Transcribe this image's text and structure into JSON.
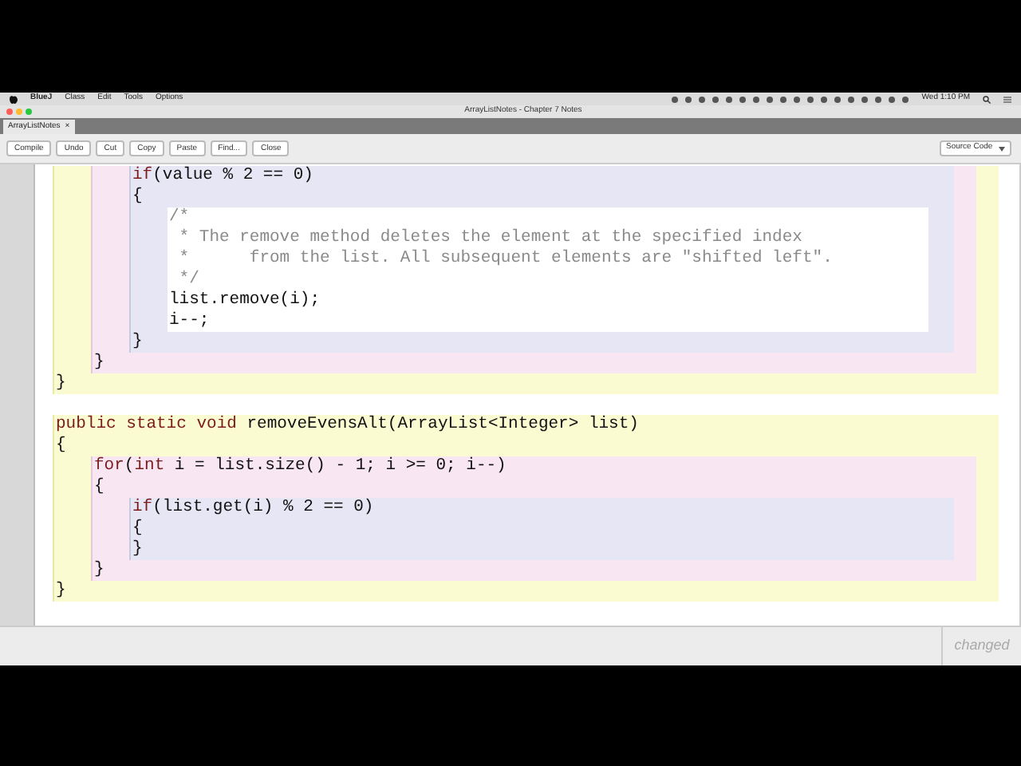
{
  "menu_bar": {
    "items": [
      "BlueJ",
      "Class",
      "Edit",
      "Tools",
      "Options"
    ],
    "clock": "Wed 1:10 PM"
  },
  "window": {
    "title": "ArrayListNotes - Chapter 7 Notes"
  },
  "tabs": [
    {
      "label": "ArrayListNotes",
      "close": "×",
      "selected": true
    }
  ],
  "toolbar": {
    "buttons": [
      "Compile",
      "Undo",
      "Cut",
      "Copy",
      "Paste",
      "Find...",
      "Close"
    ],
    "view_select": "Source Code"
  },
  "editor": {
    "items": [
      {
        "kind": "method",
        "items": [
          {
            "kind": "loop",
            "items": [
              {
                "kind": "if",
                "items": [
                  {
                    "kind": "line",
                    "tokens": [
                      {
                        "kind": "keyword",
                        "text": "if"
                      },
                      {
                        "kind": "plain",
                        "text": "(value % 2 == 0)"
                      }
                    ]
                  },
                  {
                    "kind": "line",
                    "tokens": [
                      {
                        "kind": "plain",
                        "text": "{"
                      }
                    ]
                  },
                  {
                    "kind": "comment",
                    "items": [
                      {
                        "kind": "line",
                        "tokens": [
                          {
                            "kind": "comment",
                            "text": "/*"
                          }
                        ]
                      },
                      {
                        "kind": "line",
                        "tokens": [
                          {
                            "kind": "comment",
                            "text": " * The remove method deletes the element at the specified index"
                          }
                        ]
                      },
                      {
                        "kind": "line",
                        "tokens": [
                          {
                            "kind": "comment",
                            "text": " *      from the list. All subsequent elements are \"shifted left\"."
                          }
                        ]
                      },
                      {
                        "kind": "line",
                        "tokens": [
                          {
                            "kind": "comment",
                            "text": " */"
                          }
                        ]
                      },
                      {
                        "kind": "line",
                        "tokens": [
                          {
                            "kind": "plain",
                            "text": "list.remove(i);"
                          }
                        ]
                      },
                      {
                        "kind": "line",
                        "tokens": [
                          {
                            "kind": "plain",
                            "text": "i--;"
                          }
                        ]
                      }
                    ]
                  },
                  {
                    "kind": "line",
                    "tokens": [
                      {
                        "kind": "plain",
                        "text": "}"
                      }
                    ]
                  }
                ]
              },
              {
                "kind": "line",
                "tokens": [
                  {
                    "kind": "plain",
                    "text": "}"
                  }
                ]
              }
            ]
          },
          {
            "kind": "line",
            "tokens": [
              {
                "kind": "plain",
                "text": "}"
              }
            ]
          }
        ]
      },
      {
        "kind": "blank"
      },
      {
        "kind": "method",
        "items": [
          {
            "kind": "line",
            "tokens": [
              {
                "kind": "keyword",
                "text": "public static void"
              },
              {
                "kind": "plain",
                "text": " removeEvensAlt(ArrayList<Integer> list)"
              }
            ]
          },
          {
            "kind": "line",
            "tokens": [
              {
                "kind": "plain",
                "text": "{"
              }
            ]
          },
          {
            "kind": "loop",
            "items": [
              {
                "kind": "line",
                "tokens": [
                  {
                    "kind": "keyword",
                    "text": "for"
                  },
                  {
                    "kind": "plain",
                    "text": "("
                  },
                  {
                    "kind": "keyword",
                    "text": "int"
                  },
                  {
                    "kind": "plain",
                    "text": " i = list.size() - 1; i >= 0; i--)"
                  }
                ]
              },
              {
                "kind": "line",
                "tokens": [
                  {
                    "kind": "plain",
                    "text": "{"
                  }
                ]
              },
              {
                "kind": "if",
                "items": [
                  {
                    "kind": "line",
                    "tokens": [
                      {
                        "kind": "keyword",
                        "text": "if"
                      },
                      {
                        "kind": "plain",
                        "text": "(list.get(i) % 2 == 0)"
                      }
                    ]
                  },
                  {
                    "kind": "line",
                    "tokens": [
                      {
                        "kind": "plain",
                        "text": "{"
                      }
                    ]
                  },
                  {
                    "kind": "line",
                    "tokens": [
                      {
                        "kind": "plain",
                        "text": "}"
                      }
                    ]
                  }
                ]
              },
              {
                "kind": "line",
                "tokens": [
                  {
                    "kind": "plain",
                    "text": "}"
                  }
                ]
              }
            ]
          },
          {
            "kind": "line",
            "tokens": [
              {
                "kind": "plain",
                "text": "}"
              }
            ]
          }
        ]
      }
    ]
  },
  "status_bar": {
    "text": "changed"
  }
}
